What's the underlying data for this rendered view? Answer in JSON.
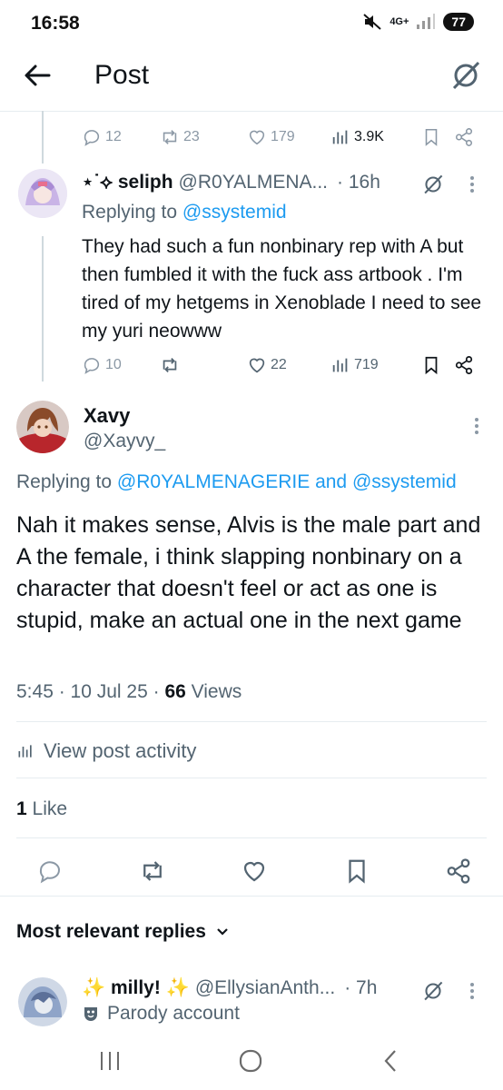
{
  "status": {
    "time": "16:58",
    "network": "4G+",
    "battery": "77"
  },
  "header": {
    "title": "Post"
  },
  "prev_post": {
    "replies": "12",
    "reposts": "23",
    "likes": "179",
    "views": "3.9K"
  },
  "reply1": {
    "display_name": "⋆˙⟡ seliph",
    "handle": "@R0YALMENA...",
    "time": "· 16h",
    "replying_label": "Replying to",
    "replying_to": "@ssystemid",
    "text": "They had such a fun nonbinary rep with A but then fumbled it with the fuck ass artbook . I'm tired of my hetgems in Xenoblade I need to see my yuri neowww",
    "replies": "10",
    "reposts": "",
    "likes": "22",
    "views": "719"
  },
  "main": {
    "display_name": "Xavy",
    "handle": "@Xayvy_",
    "replying_label": "Replying to",
    "replying_to_1": "@R0YALMENAGERIE",
    "and_label": "and",
    "replying_to_2": "@ssystemid",
    "text": "Nah it makes sense, Alvis is the male part and A the female, i think slapping nonbinary on a character that doesn't feel or act as one is stupid, make an actual one in the next game",
    "timestamp": "5:45 · 10 Jul 25 ·",
    "views_count": "66",
    "views_label": "Views",
    "activity_label": "View post activity",
    "likes_count": "1",
    "likes_label": "Like"
  },
  "replies_section": {
    "sort_label": "Most relevant replies"
  },
  "reply2": {
    "display_name": "✨ milly! ✨",
    "handle": "@EllysianAnth...",
    "time": "· 7h",
    "badge": "Parody account"
  },
  "colors": {
    "accent": "#1d9bf0",
    "muted": "#536471",
    "text": "#0f1419"
  },
  "icons": [
    "back-arrow-icon",
    "grok-icon",
    "reply-icon",
    "repost-icon",
    "like-icon",
    "views-icon",
    "bookmark-icon",
    "share-icon",
    "more-icon",
    "chevron-down-icon",
    "mask-icon"
  ]
}
